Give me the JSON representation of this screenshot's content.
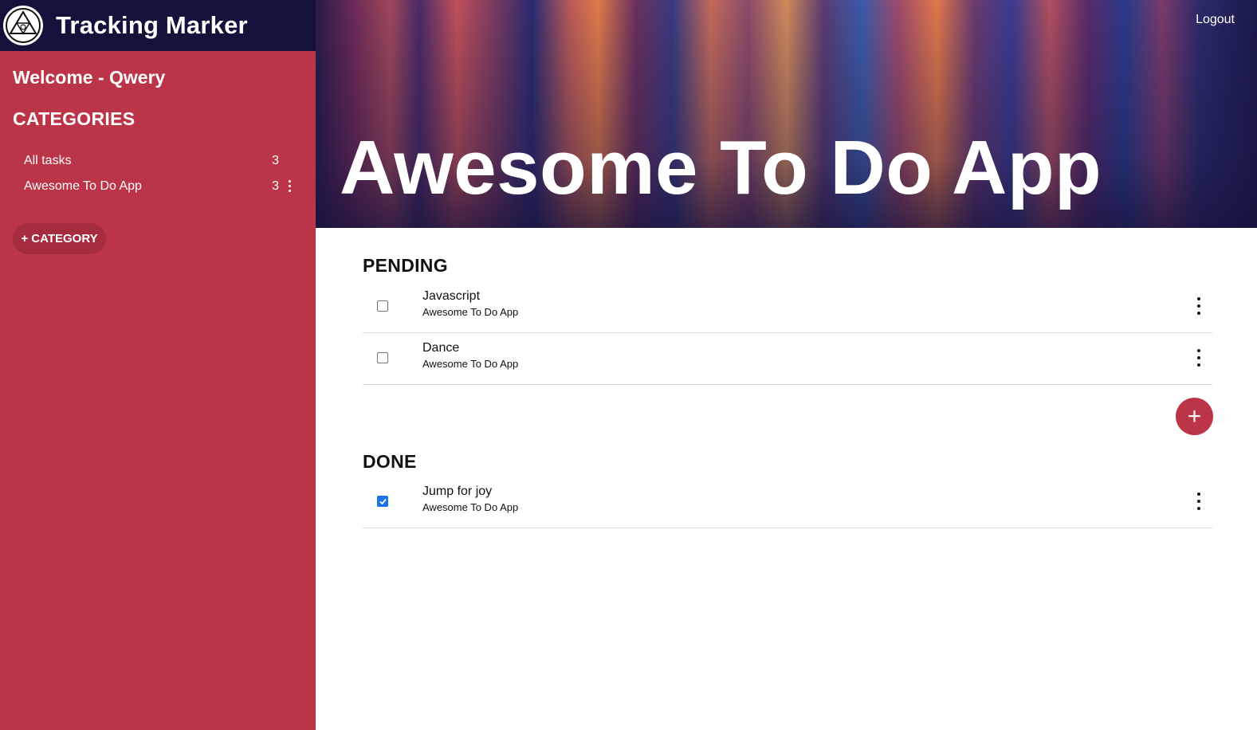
{
  "brand": {
    "title": "Tracking Marker",
    "logo_icon": "triangle-emblem-icon"
  },
  "sidebar": {
    "welcome": "Welcome - Qwery",
    "categories_heading": "CATEGORIES",
    "categories": [
      {
        "label": "All tasks",
        "count": "3"
      },
      {
        "label": "Awesome To Do App",
        "count": "3"
      }
    ],
    "add_category_label": "+ CATEGORY"
  },
  "header": {
    "logout_label": "Logout",
    "hero_title": "Awesome To Do App"
  },
  "pending": {
    "title": "PENDING",
    "tasks": [
      {
        "name": "Javascript",
        "category": "Awesome To Do App",
        "done": false
      },
      {
        "name": "Dance",
        "category": "Awesome To Do App",
        "done": false
      }
    ]
  },
  "done": {
    "title": "DONE",
    "tasks": [
      {
        "name": "Jump for joy",
        "category": "Awesome To Do App",
        "done": true
      }
    ]
  },
  "fab_label": "+",
  "colors": {
    "accent": "#bb3447",
    "brand_bar": "#14123a",
    "checkbox_checked": "#1a73e8"
  }
}
